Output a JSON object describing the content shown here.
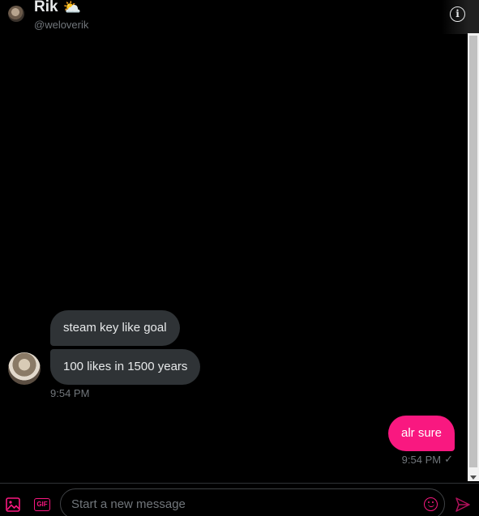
{
  "header": {
    "title": "Rik",
    "weather_emoji": "⛅",
    "handle": "@weloverik",
    "info_glyph": "i"
  },
  "conversation": {
    "incoming": [
      {
        "text": "steam key like goal"
      },
      {
        "text": "100 likes in 1500 years"
      }
    ],
    "incoming_time": "9:54 PM",
    "outgoing": [
      {
        "text": "alr sure"
      }
    ],
    "outgoing_time": "9:54 PM",
    "outgoing_status_glyph": "✓"
  },
  "composer": {
    "placeholder": "Start a new message",
    "gif_label": "GIF"
  },
  "colors": {
    "accent": "#f91880",
    "bubble_incoming": "#2f3336",
    "background": "#000000",
    "muted_text": "#71767b"
  }
}
